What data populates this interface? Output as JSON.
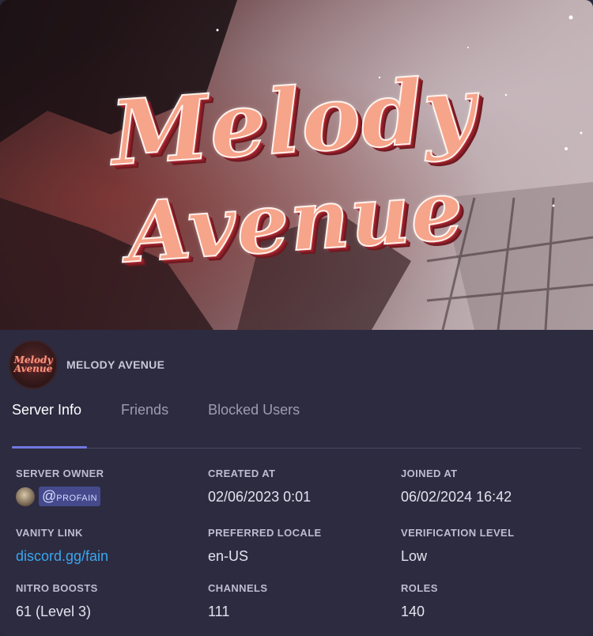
{
  "banner": {
    "title_line1": "Melody",
    "title_line2": "Avenue"
  },
  "server": {
    "avatar_text_line1": "Melody",
    "avatar_text_line2": "Avenue",
    "name": "MELODY AVENUE"
  },
  "tabs": [
    {
      "label": "Server Info",
      "active": true
    },
    {
      "label": "Friends",
      "active": false
    },
    {
      "label": "Blocked Users",
      "active": false
    }
  ],
  "info": {
    "server_owner": {
      "label": "SERVER OWNER",
      "at": "@",
      "handle": "profain"
    },
    "created_at": {
      "label": "CREATED AT",
      "value": "02/06/2023 0:01"
    },
    "joined_at": {
      "label": "JOINED AT",
      "value": "06/02/2024 16:42"
    },
    "vanity_link": {
      "label": "VANITY LINK",
      "value": "discord.gg/fain"
    },
    "preferred_locale": {
      "label": "PREFERRED LOCALE",
      "value": "en-US"
    },
    "verification_level": {
      "label": "VERIFICATION LEVEL",
      "value": "Low"
    },
    "nitro_boosts": {
      "label": "NITRO BOOSTS",
      "value": "61 (Level 3)"
    },
    "channels": {
      "label": "CHANNELS",
      "value": "111"
    },
    "roles": {
      "label": "ROLES",
      "value": "140"
    }
  },
  "colors": {
    "background": "#2d2b40",
    "accent": "#6f79e0",
    "link": "#3aa6f0",
    "mention_bg": "#444a8c",
    "title_fill": "#f6a48a"
  }
}
